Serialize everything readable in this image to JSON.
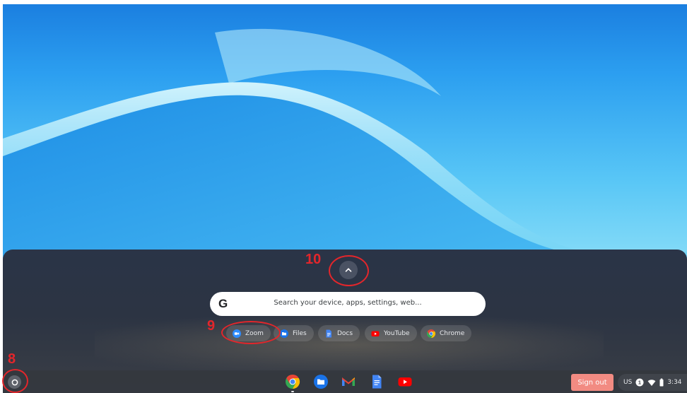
{
  "launcher": {
    "search_placeholder": "Search your device, apps, settings, web...",
    "google_logo": "G",
    "expand_icon": "chevron-up-icon",
    "suggestions": [
      {
        "label": "Zoom",
        "icon": "zoom-icon",
        "color": "#2d8cff"
      },
      {
        "label": "Files",
        "icon": "folder-icon",
        "color": "#1a73e8"
      },
      {
        "label": "Docs",
        "icon": "docs-icon",
        "color": "#4285f4"
      },
      {
        "label": "YouTube",
        "icon": "youtube-icon",
        "color": "#ff0000"
      },
      {
        "label": "Chrome",
        "icon": "chrome-icon",
        "color": "#fbbc04"
      }
    ]
  },
  "shelf": {
    "launcher_icon": "launcher-circle-icon",
    "pinned_apps": [
      {
        "name": "Chrome",
        "icon": "chrome-icon",
        "running": true
      },
      {
        "name": "Files",
        "icon": "folder-icon",
        "running": false
      },
      {
        "name": "Gmail",
        "icon": "gmail-icon",
        "running": false
      },
      {
        "name": "Docs",
        "icon": "docs-icon",
        "running": false
      },
      {
        "name": "YouTube",
        "icon": "youtube-icon",
        "running": false
      }
    ],
    "sign_out_label": "Sign out",
    "tray": {
      "keyboard_layout": "US",
      "notification_count": "1",
      "time": "3:34"
    }
  },
  "annotations": {
    "launcher_button": "8",
    "zoom_suggestion": "9",
    "expand_button": "10",
    "color": "#e3262b"
  },
  "colors": {
    "sign_out": "#f28b82",
    "launcher_panel": "#2c3443"
  }
}
